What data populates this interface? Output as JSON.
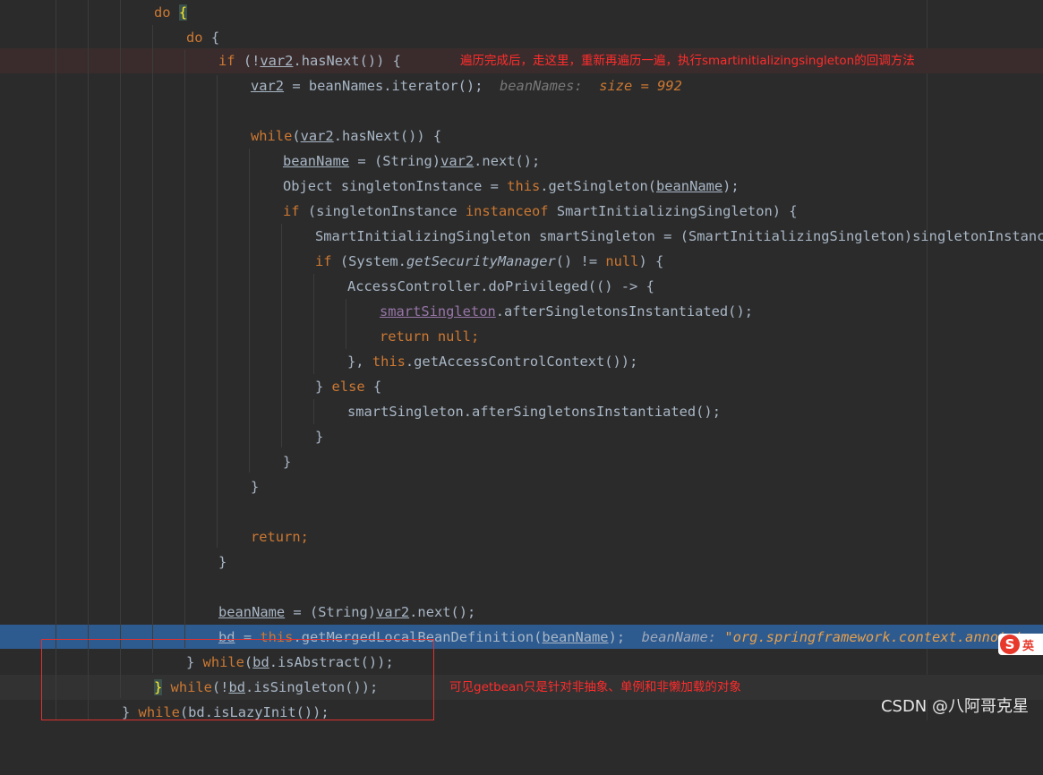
{
  "code": {
    "l0": {
      "kw": "do",
      "brace": "{"
    },
    "l1": {
      "kw": "do",
      "rest": " {"
    },
    "l2": {
      "kw": "if",
      "a": " (!",
      "var": "var2",
      "b": ".hasNext()) {"
    },
    "l3": {
      "var": "var2",
      "a": " = beanNames.iterator();",
      "hint_name": "beanNames:",
      "hint_key": "size = 992"
    },
    "l5": {
      "kw": "while",
      "a": "(",
      "var": "var2",
      "b": ".hasNext()) {"
    },
    "l6": {
      "var1": "beanName",
      "a": " = (String)",
      "var2": "var2",
      "b": ".next();"
    },
    "l7": {
      "a": "Object singletonInstance = ",
      "kw": "this",
      "b": ".getSingleton(",
      "var": "beanName",
      "c": ");"
    },
    "l8": {
      "kw": "if",
      "a": " (singletonInstance ",
      "kw2": "instanceof",
      "b": " SmartInitializingSingleton) {"
    },
    "l9": {
      "a": "SmartInitializingSingleton smartSingleton = (SmartInitializingSingleton)singletonInstance;"
    },
    "l10": {
      "kw": "if",
      "a": " (System.",
      "method": "getSecurityManager",
      "b": "() != ",
      "kw2": "null",
      "c": ") {"
    },
    "l11": {
      "a": "AccessController.doPrivileged(() -> {"
    },
    "l12": {
      "var": "smartSingleton",
      "a": ".afterSingletonsInstantiated();"
    },
    "l13": {
      "kw": "return null",
      "a": ";"
    },
    "l14": {
      "a": "}, ",
      "kw": "this",
      "b": ".getAccessControlContext());"
    },
    "l15": {
      "a": "} ",
      "kw": "else",
      "b": " {"
    },
    "l16": {
      "a": "smartSingleton.afterSingletonsInstantiated();"
    },
    "l17": {
      "a": "}"
    },
    "l18": {
      "a": "}"
    },
    "l19": {
      "a": "}"
    },
    "l21": {
      "kw": "return",
      "a": ";"
    },
    "l22": {
      "a": "}"
    },
    "l24": {
      "var1": "beanName",
      "a": " = (String)",
      "var2": "var2",
      "b": ".next();"
    },
    "l25": {
      "var1": "bd",
      "a": " = ",
      "kw": "this",
      "b": ".getMergedLocalBeanDefinition(",
      "var2": "beanName",
      "c": ");",
      "hint_name": "beanName:",
      "hint_val": "\"org.springframework.context.annotat"
    },
    "l26": {
      "a": "} ",
      "kw": "while",
      "b": "(",
      "var": "bd",
      "c": ".isAbstract());"
    },
    "l27": {
      "brace": "}",
      "kw": " while",
      "b": "(!",
      "var": "bd",
      "c": ".isSingleton());"
    },
    "l28": {
      "a": "} ",
      "kw": "while",
      "b": "(bd.isLazyInit());"
    }
  },
  "annotations": {
    "top": "遍历完成后，走这里，重新再遍历一遍，执行smartinitializingsingleton的回调方法",
    "bottom": "可见getbean只是针对非抽象、单例和非懒加载的对象"
  },
  "watermark": "CSDN @八阿哥克星",
  "ime": {
    "logo": "S",
    "mode": "英"
  },
  "colors": {
    "background": "#2b2b2b",
    "keyword": "#cc7832",
    "annotation": "#ff2c2c",
    "execution_line": "#2d5a8f"
  }
}
